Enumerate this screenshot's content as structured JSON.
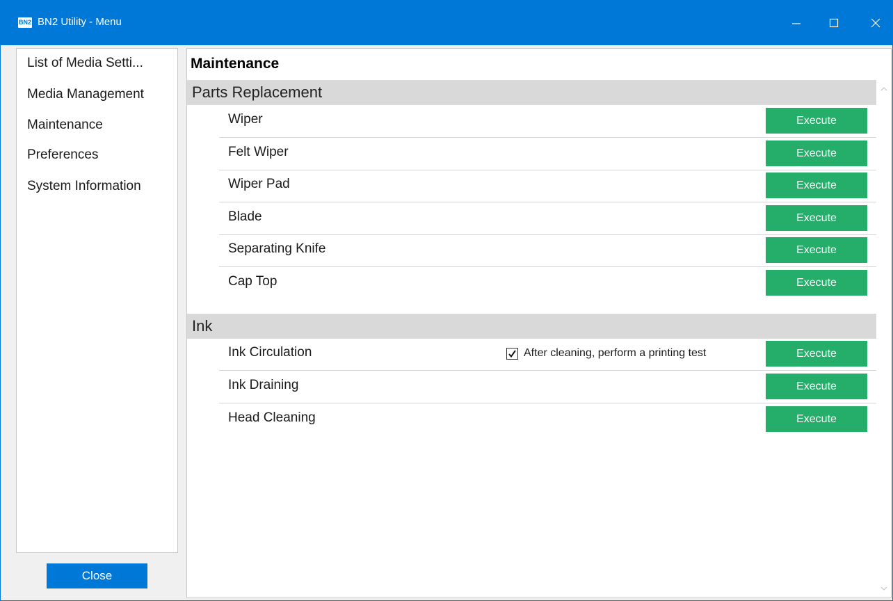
{
  "window": {
    "title": "BN2 Utility - Menu",
    "app_icon_text": "BN2"
  },
  "sidebar": {
    "items": [
      {
        "label": "List of Media Setti..."
      },
      {
        "label": "Media Management"
      },
      {
        "label": "Maintenance"
      },
      {
        "label": "Preferences"
      },
      {
        "label": "System Information"
      }
    ],
    "close_label": "Close"
  },
  "main": {
    "title": "Maintenance",
    "sections": [
      {
        "header": "Parts Replacement",
        "rows": [
          {
            "label": "Wiper",
            "button": "Execute"
          },
          {
            "label": "Felt Wiper",
            "button": "Execute"
          },
          {
            "label": "Wiper Pad",
            "button": "Execute"
          },
          {
            "label": "Blade",
            "button": "Execute"
          },
          {
            "label": "Separating Knife",
            "button": "Execute"
          },
          {
            "label": "Cap Top",
            "button": "Execute"
          }
        ]
      },
      {
        "header": "Ink",
        "rows": [
          {
            "label": "Ink Circulation",
            "button": "Execute",
            "checkbox": {
              "label": "After cleaning, perform a printing test",
              "checked": true
            }
          },
          {
            "label": "Ink Draining",
            "button": "Execute"
          },
          {
            "label": "Head Cleaning",
            "button": "Execute"
          }
        ]
      }
    ]
  },
  "colors": {
    "titlebar": "#0078d7",
    "execute_button": "#25ae6a",
    "close_button": "#0078d7",
    "section_header": "#d9d9d9"
  },
  "icons": [
    "app-icon",
    "minimize-icon",
    "maximize-icon",
    "close-icon",
    "checkmark-icon",
    "scroll-up-icon",
    "scroll-down-icon"
  ]
}
